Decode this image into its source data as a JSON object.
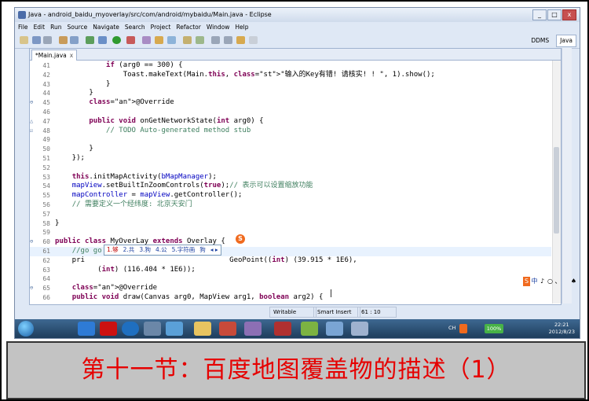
{
  "window": {
    "title": "Java - android_baidu_myoverlay/src/com/android/mybaidu/Main.java - Eclipse",
    "controls": [
      "_",
      "□",
      "x"
    ]
  },
  "menu": [
    "File",
    "Edit",
    "Run",
    "Source",
    "Navigate",
    "Search",
    "Project",
    "Refactor",
    "Window",
    "Help"
  ],
  "perspectives": {
    "ddms": "DDMS",
    "java": "Java"
  },
  "editor": {
    "tab_label": "*Main.java",
    "tab_close": "x",
    "lines": [
      {
        "n": "41",
        "t": "            if (arg0 == 300) {"
      },
      {
        "n": "42",
        "t": "                Toast.makeText(Main.this, \"输入的Key有错! 请核实! ! \", 1).show();"
      },
      {
        "n": "43",
        "t": "            }"
      },
      {
        "n": "44",
        "t": "        }"
      },
      {
        "n": "45",
        "t": "        @Override",
        "mark": "⊖"
      },
      {
        "n": "46",
        "t": ""
      },
      {
        "n": "47",
        "t": "        public void onGetNetworkState(int arg0) {",
        "mark": "△"
      },
      {
        "n": "48",
        "t": "            // TODO Auto-generated method stub",
        "mark": "☑"
      },
      {
        "n": "49",
        "t": ""
      },
      {
        "n": "50",
        "t": "        }"
      },
      {
        "n": "51",
        "t": "    });"
      },
      {
        "n": "52",
        "t": ""
      },
      {
        "n": "53",
        "t": "    this.initMapActivity(bMapManager);"
      },
      {
        "n": "54",
        "t": "    mapView.setBuiltInZoomControls(true);// 表示可以设置缩放功能"
      },
      {
        "n": "55",
        "t": "    mapController = mapView.getController();"
      },
      {
        "n": "56",
        "t": "    // 需要定义一个经纬度: 北京天安门"
      },
      {
        "n": "57",
        "t": ""
      },
      {
        "n": "58",
        "t": "}"
      },
      {
        "n": "59",
        "t": ""
      },
      {
        "n": "60",
        "t": "public class MyOverLay extends Overlay {",
        "mark": "⊖"
      },
      {
        "n": "61",
        "t": "    //go go"
      },
      {
        "n": "62",
        "t": "    pri                                  GeoPoint((int) (39.915 * 1E6),"
      },
      {
        "n": "63",
        "t": "          (int) (116.404 * 1E6));"
      },
      {
        "n": "64",
        "t": ""
      },
      {
        "n": "65",
        "t": "    @Override",
        "mark": "⊖"
      },
      {
        "n": "66",
        "t": "    public void draw(Canvas arg0, MapView arg1, boolean arg2) {"
      }
    ]
  },
  "ime": {
    "candidates": [
      "1.够",
      "2.共",
      "3.狗",
      "4.公",
      "5.字符画",
      "狗"
    ],
    "arrows": "◂ ▸",
    "logo": "S",
    "bar": [
      "S",
      "中",
      "♪",
      "○",
      "、",
      "囲",
      "♠",
      "♩"
    ]
  },
  "status": {
    "writable": "Writable",
    "insert_mode": "Smart Insert",
    "position": "61 : 10"
  },
  "taskbar": {
    "battery": "100%",
    "time": "22:21",
    "date": "2012/8/23",
    "lang": "CH"
  },
  "caption": "第十一节：百度地图覆盖物的描述（1）"
}
